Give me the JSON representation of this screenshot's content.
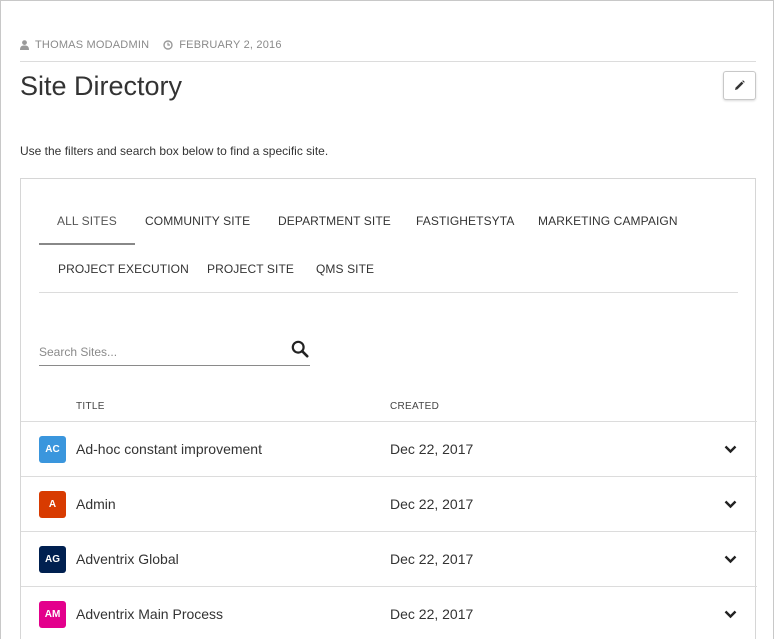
{
  "meta": {
    "author": "THOMAS MODADMIN",
    "date": "FEBRUARY 2, 2016"
  },
  "page": {
    "title": "Site Directory",
    "intro": "Use the filters and search box below to find a specific site."
  },
  "tabs": [
    {
      "label": "ALL SITES",
      "active": true
    },
    {
      "label": "COMMUNITY SITE"
    },
    {
      "label": "DEPARTMENT SITE"
    },
    {
      "label": "FASTIGHETSYTA"
    },
    {
      "label": "MARKETING CAMPAIGN"
    },
    {
      "label": "PROJECT EXECUTION"
    },
    {
      "label": "PROJECT SITE"
    },
    {
      "label": "QMS SITE"
    }
  ],
  "search": {
    "placeholder": "Search Sites...",
    "value": ""
  },
  "table": {
    "columns": {
      "title": "TITLE",
      "created": "CREATED"
    },
    "rows": [
      {
        "initials": "AC",
        "color": "#3a96dd",
        "title": "Ad-hoc constant improvement",
        "created": "Dec 22, 2017"
      },
      {
        "initials": "A",
        "color": "#d83b01",
        "title": "Admin",
        "created": "Dec 22, 2017"
      },
      {
        "initials": "AG",
        "color": "#002050",
        "title": "Adventrix Global",
        "created": "Dec 22, 2017"
      },
      {
        "initials": "AM",
        "color": "#e3008c",
        "title": "Adventrix Main Process",
        "created": "Dec 22, 2017"
      }
    ]
  },
  "icons": {
    "author": "user-icon",
    "date": "clock-icon",
    "edit": "pencil-icon",
    "search": "search-icon",
    "expand": "chevron-down-icon"
  }
}
